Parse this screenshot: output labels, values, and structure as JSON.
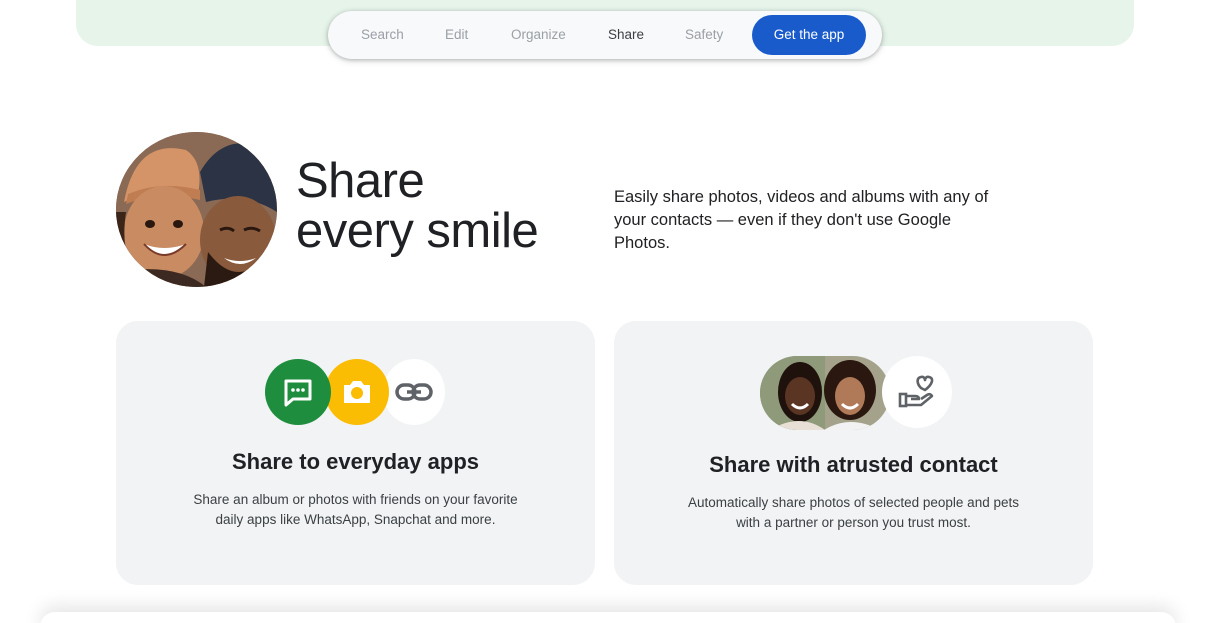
{
  "nav": {
    "items": [
      {
        "label": "Search",
        "active": false
      },
      {
        "label": "Edit",
        "active": false
      },
      {
        "label": "Organize",
        "active": false
      },
      {
        "label": "Share",
        "active": true
      },
      {
        "label": "Safety",
        "active": false
      }
    ],
    "cta_label": "Get the app"
  },
  "hero": {
    "title_line1": "Share",
    "title_line2": "every smile",
    "description": "Easily share photos, videos and albums with any of your contacts — even if they don't use Google Photos."
  },
  "cards": [
    {
      "title": "Share to everyday apps",
      "description_line1": "Share an album or photos with friends on your favorite",
      "description_line2": "daily apps like WhatsApp, Snapchat and more.",
      "icons": [
        "chat-icon",
        "camera-icon",
        "link-icon"
      ]
    },
    {
      "title": "Share with atrusted contact",
      "description_line1": "Automatically share photos of selected people and pets",
      "description_line2": "with a partner or person you trust most.",
      "icons": [
        "heart-hand-icon"
      ]
    }
  ],
  "colors": {
    "band": "#e6f4ea",
    "cta": "#1a5bcc",
    "green": "#1e8e3e",
    "yellow": "#fbbc04",
    "card_bg": "#f1f3f4"
  }
}
